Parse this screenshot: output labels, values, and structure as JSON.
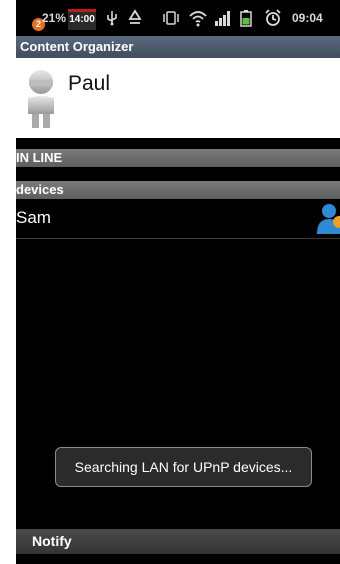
{
  "status_bar": {
    "battery_badge": "2",
    "battery_text": "21%",
    "alarm_time": "14:00",
    "clock": "09:04",
    "icons": [
      "usb-icon",
      "recycle-icon",
      "vibrate-icon",
      "wifi-icon",
      "signal-icon",
      "battery-icon",
      "alarm-icon"
    ]
  },
  "app": {
    "title": "Content Organizer"
  },
  "profile": {
    "name": "Paul"
  },
  "sections": {
    "online_header": "IN LINE",
    "devices_header": "devices"
  },
  "devices": [
    {
      "name": "Sam",
      "icon": "user-icon"
    }
  ],
  "toast": {
    "message": "Searching LAN for UPnP devices..."
  },
  "bottom_bar": {
    "notify_label": "Notify"
  },
  "colors": {
    "title_bar": "#4a596b",
    "section_header": "#6b6b6b",
    "user_icon_blue": "#2f8ad6",
    "user_icon_orange": "#f0a020"
  }
}
